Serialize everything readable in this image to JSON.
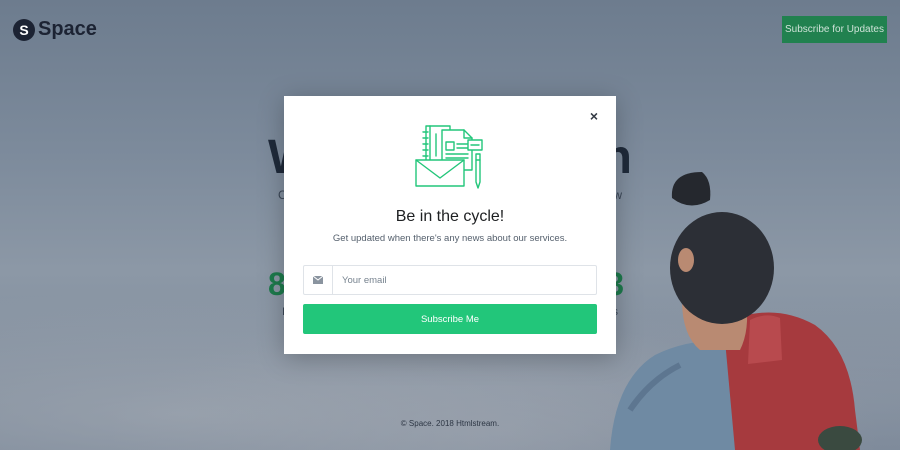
{
  "header": {
    "logo_letter": "S",
    "logo_text": "Space",
    "subscribe_label": "Subscribe for Updates"
  },
  "background": {
    "headline_start": "W",
    "headline_end": "n",
    "sub_start": "C",
    "sub_end": "w",
    "num_start": "8",
    "num_end": "3",
    "num_label_start": "I",
    "num_label_end": "s"
  },
  "modal": {
    "close_glyph": "×",
    "title": "Be in the cycle!",
    "description": "Get updated when there's any news about our services.",
    "email_placeholder": "Your email",
    "submit_label": "Subscribe Me"
  },
  "footer": {
    "copyright": "© Space. 2018 Htmlstream."
  },
  "colors": {
    "accent": "#22c67a",
    "header_button": "#21814f",
    "icon_stroke": "#22c67a"
  },
  "icons": {
    "email": "envelope-icon",
    "close": "close-icon",
    "illustration": "newsletter-illustration-icon"
  }
}
